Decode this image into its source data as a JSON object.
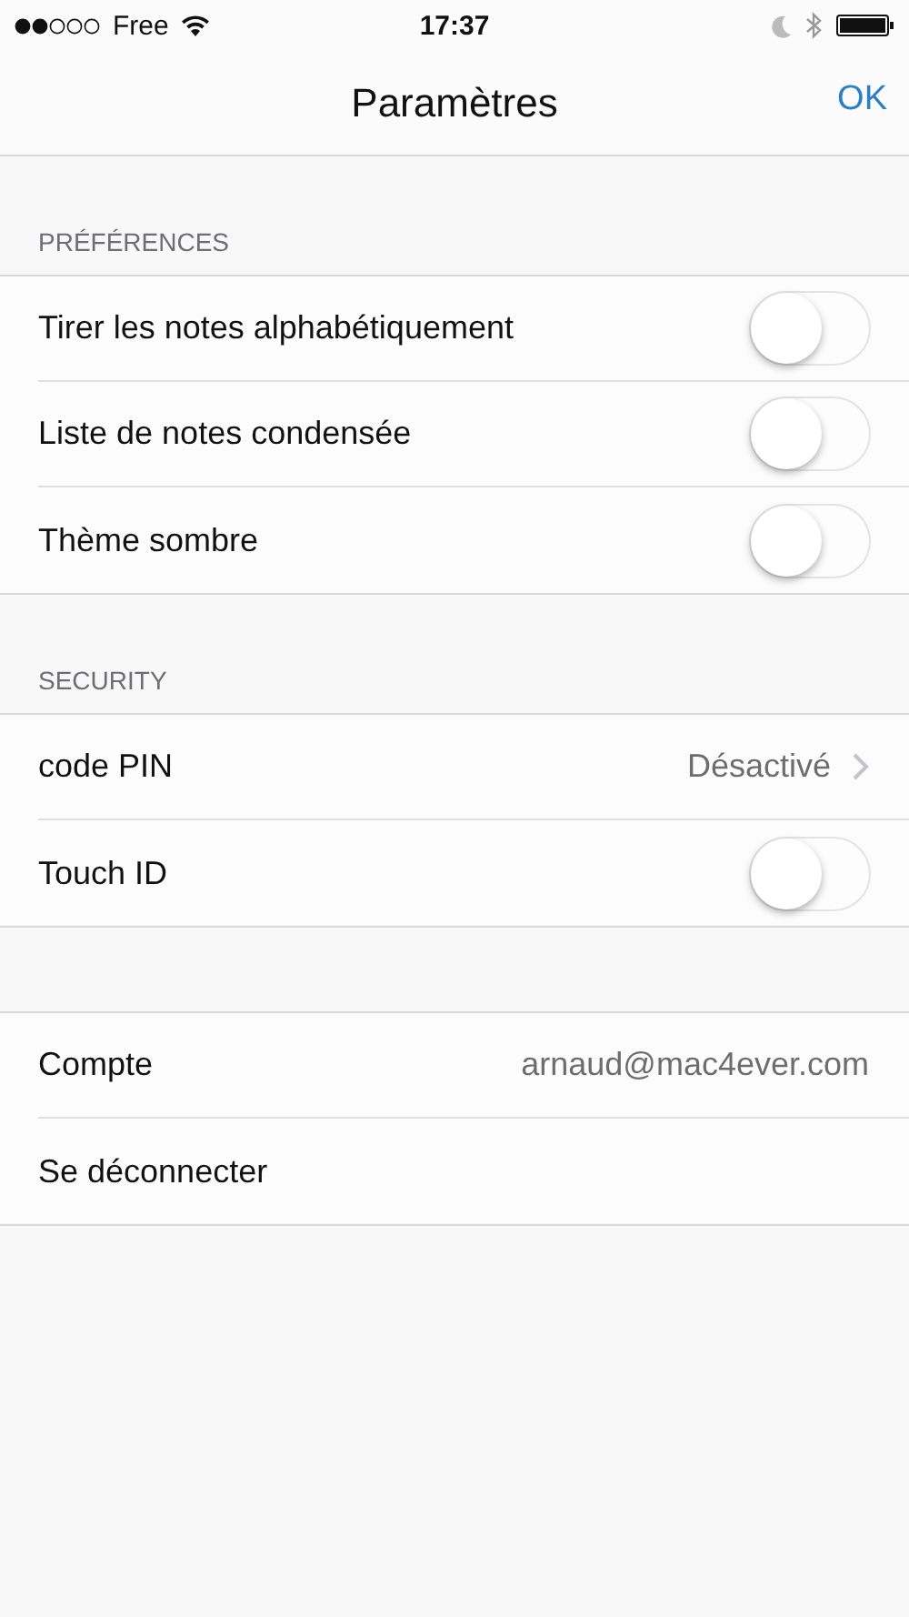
{
  "status_bar": {
    "carrier": "Free",
    "time": "17:37"
  },
  "nav_bar": {
    "title": "Paramètres",
    "action": "OK"
  },
  "sections": [
    {
      "header": "PRÉFÉRENCES",
      "items": [
        {
          "kind": "toggle",
          "label": "Tirer les notes alphabétiquement",
          "on": false
        },
        {
          "kind": "toggle",
          "label": "Liste de notes condensée",
          "on": false
        },
        {
          "kind": "toggle",
          "label": "Thème sombre",
          "on": false
        }
      ]
    },
    {
      "header": "SECURITY",
      "items": [
        {
          "kind": "disclosure",
          "label": "code PIN",
          "value": "Désactivé"
        },
        {
          "kind": "toggle",
          "label": "Touch ID",
          "on": false
        }
      ]
    },
    {
      "items": [
        {
          "kind": "value",
          "label": "Compte",
          "value": "arnaud@mac4ever.com"
        },
        {
          "kind": "action",
          "label": "Se déconnecter"
        }
      ]
    }
  ]
}
